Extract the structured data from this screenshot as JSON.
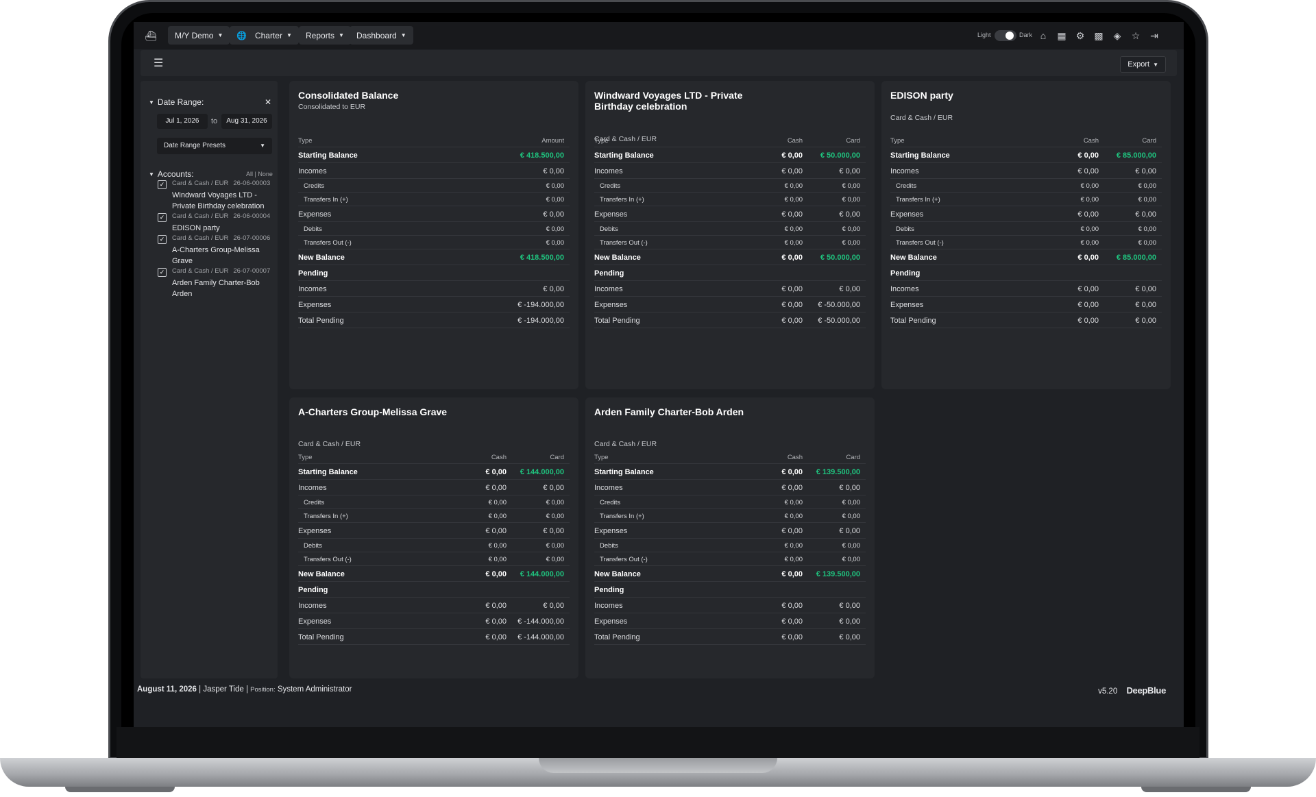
{
  "nav": {
    "vessel": "M/Y Demo",
    "charter": "Charter",
    "reports": "Reports",
    "dashboard": "Dashboard",
    "theme_light": "Light",
    "theme_dark": "Dark"
  },
  "toolbar": {
    "export_label": "Export"
  },
  "sidebar": {
    "date_range_label": "Date Range:",
    "date_from": "Jul 1, 2026",
    "to_label": "to",
    "date_to": "Aug 31, 2026",
    "presets_label": "Date Range Presets",
    "accounts_label": "Accounts:",
    "all_none": "All | None",
    "accounts": [
      {
        "type": "Card & Cash / EUR",
        "number": "26-06-00003",
        "name": "Windward Voyages LTD - Private Birthday celebration"
      },
      {
        "type": "Card & Cash / EUR",
        "number": "26-06-00004",
        "name": "EDISON party"
      },
      {
        "type": "Card & Cash / EUR",
        "number": "26-07-00006",
        "name": "A-Charters Group-Melissa Grave"
      },
      {
        "type": "Card & Cash / EUR",
        "number": "26-07-00007",
        "name": "Arden Family Charter-Bob Arden"
      }
    ]
  },
  "consolidated": {
    "title": "Consolidated Balance",
    "subtitle": "Consolidated to EUR",
    "col_type": "Type",
    "col_amount": "Amount",
    "rows": [
      {
        "label": "Starting Balance",
        "value": "€ 418.500,00"
      },
      {
        "label": "Incomes",
        "value": "€ 0,00"
      },
      {
        "label": "Credits",
        "value": "€ 0,00"
      },
      {
        "label": "Transfers In (+)",
        "value": "€ 0,00"
      },
      {
        "label": "Expenses",
        "value": "€ 0,00"
      },
      {
        "label": "Debits",
        "value": "€ 0,00"
      },
      {
        "label": "Transfers Out (-)",
        "value": "€ 0,00"
      },
      {
        "label": "New Balance",
        "value": "€ 418.500,00"
      },
      {
        "label": "Pending",
        "value": ""
      },
      {
        "label": "Incomes",
        "value": "€ 0,00"
      },
      {
        "label": "Expenses",
        "value": "€ -194.000,00"
      },
      {
        "label": "Total Pending",
        "value": "€ -194.000,00"
      }
    ]
  },
  "account_panels": [
    {
      "title": "Windward Voyages LTD - Private Birthday celebration",
      "subtitle": "Card & Cash / EUR",
      "col_type": "Type",
      "col_cash": "Cash",
      "col_card": "Card",
      "rows": [
        {
          "label": "Starting Balance",
          "cash": "€ 0,00",
          "card": "€ 50.000,00"
        },
        {
          "label": "Incomes",
          "cash": "€ 0,00",
          "card": "€ 0,00"
        },
        {
          "label": "Credits",
          "cash": "€ 0,00",
          "card": "€ 0,00"
        },
        {
          "label": "Transfers In (+)",
          "cash": "€ 0,00",
          "card": "€ 0,00"
        },
        {
          "label": "Expenses",
          "cash": "€ 0,00",
          "card": "€ 0,00"
        },
        {
          "label": "Debits",
          "cash": "€ 0,00",
          "card": "€ 0,00"
        },
        {
          "label": "Transfers Out (-)",
          "cash": "€ 0,00",
          "card": "€ 0,00"
        },
        {
          "label": "New Balance",
          "cash": "€ 0,00",
          "card": "€ 50.000,00"
        },
        {
          "label": "Pending",
          "cash": "",
          "card": ""
        },
        {
          "label": "Incomes",
          "cash": "€ 0,00",
          "card": "€ 0,00"
        },
        {
          "label": "Expenses",
          "cash": "€ 0,00",
          "card": "€ -50.000,00"
        },
        {
          "label": "Total Pending",
          "cash": "€ 0,00",
          "card": "€ -50.000,00"
        }
      ]
    },
    {
      "title": "EDISON party",
      "subtitle": "Card & Cash / EUR",
      "col_type": "Type",
      "col_cash": "Cash",
      "col_card": "Card",
      "rows": [
        {
          "label": "Starting Balance",
          "cash": "€ 0,00",
          "card": "€ 85.000,00"
        },
        {
          "label": "Incomes",
          "cash": "€ 0,00",
          "card": "€ 0,00"
        },
        {
          "label": "Credits",
          "cash": "€ 0,00",
          "card": "€ 0,00"
        },
        {
          "label": "Transfers In (+)",
          "cash": "€ 0,00",
          "card": "€ 0,00"
        },
        {
          "label": "Expenses",
          "cash": "€ 0,00",
          "card": "€ 0,00"
        },
        {
          "label": "Debits",
          "cash": "€ 0,00",
          "card": "€ 0,00"
        },
        {
          "label": "Transfers Out (-)",
          "cash": "€ 0,00",
          "card": "€ 0,00"
        },
        {
          "label": "New Balance",
          "cash": "€ 0,00",
          "card": "€ 85.000,00"
        },
        {
          "label": "Pending",
          "cash": "",
          "card": ""
        },
        {
          "label": "Incomes",
          "cash": "€ 0,00",
          "card": "€ 0,00"
        },
        {
          "label": "Expenses",
          "cash": "€ 0,00",
          "card": "€ 0,00"
        },
        {
          "label": "Total Pending",
          "cash": "€ 0,00",
          "card": "€ 0,00"
        }
      ]
    },
    {
      "title": "A-Charters Group-Melissa Grave",
      "subtitle": "Card & Cash / EUR",
      "col_type": "Type",
      "col_cash": "Cash",
      "col_card": "Card",
      "rows": [
        {
          "label": "Starting Balance",
          "cash": "€ 0,00",
          "card": "€ 144.000,00"
        },
        {
          "label": "Incomes",
          "cash": "€ 0,00",
          "card": "€ 0,00"
        },
        {
          "label": "Credits",
          "cash": "€ 0,00",
          "card": "€ 0,00"
        },
        {
          "label": "Transfers In (+)",
          "cash": "€ 0,00",
          "card": "€ 0,00"
        },
        {
          "label": "Expenses",
          "cash": "€ 0,00",
          "card": "€ 0,00"
        },
        {
          "label": "Debits",
          "cash": "€ 0,00",
          "card": "€ 0,00"
        },
        {
          "label": "Transfers Out (-)",
          "cash": "€ 0,00",
          "card": "€ 0,00"
        },
        {
          "label": "New Balance",
          "cash": "€ 0,00",
          "card": "€ 144.000,00"
        },
        {
          "label": "Pending",
          "cash": "",
          "card": ""
        },
        {
          "label": "Incomes",
          "cash": "€ 0,00",
          "card": "€ 0,00"
        },
        {
          "label": "Expenses",
          "cash": "€ 0,00",
          "card": "€ -144.000,00"
        },
        {
          "label": "Total Pending",
          "cash": "€ 0,00",
          "card": "€ -144.000,00"
        }
      ]
    },
    {
      "title": "Arden Family Charter-Bob Arden",
      "subtitle": "Card & Cash / EUR",
      "col_type": "Type",
      "col_cash": "Cash",
      "col_card": "Card",
      "rows": [
        {
          "label": "Starting Balance",
          "cash": "€ 0,00",
          "card": "€ 139.500,00"
        },
        {
          "label": "Incomes",
          "cash": "€ 0,00",
          "card": "€ 0,00"
        },
        {
          "label": "Credits",
          "cash": "€ 0,00",
          "card": "€ 0,00"
        },
        {
          "label": "Transfers In (+)",
          "cash": "€ 0,00",
          "card": "€ 0,00"
        },
        {
          "label": "Expenses",
          "cash": "€ 0,00",
          "card": "€ 0,00"
        },
        {
          "label": "Debits",
          "cash": "€ 0,00",
          "card": "€ 0,00"
        },
        {
          "label": "Transfers Out (-)",
          "cash": "€ 0,00",
          "card": "€ 0,00"
        },
        {
          "label": "New Balance",
          "cash": "€ 0,00",
          "card": "€ 139.500,00"
        },
        {
          "label": "Pending",
          "cash": "",
          "card": ""
        },
        {
          "label": "Incomes",
          "cash": "€ 0,00",
          "card": "€ 0,00"
        },
        {
          "label": "Expenses",
          "cash": "€ 0,00",
          "card": "€ 0,00"
        },
        {
          "label": "Total Pending",
          "cash": "€ 0,00",
          "card": "€ 0,00"
        }
      ]
    }
  ],
  "status": {
    "date": "August 11, 2026",
    "user": "Jasper Tide",
    "position_label": "Position:",
    "position": "System Administrator",
    "version": "v5.20",
    "brand": "DeepBlue"
  },
  "colors": {
    "positive": "#1fc47f",
    "background": "#1f2125",
    "panel": "#26282c"
  },
  "icons": [
    "ship-icon",
    "globe-icon",
    "home-icon",
    "calendar-icon",
    "gear-icon",
    "qr-icon",
    "tag-icon",
    "star-icon",
    "logout-icon",
    "menu-icon",
    "close-icon",
    "checkbox-icon"
  ]
}
